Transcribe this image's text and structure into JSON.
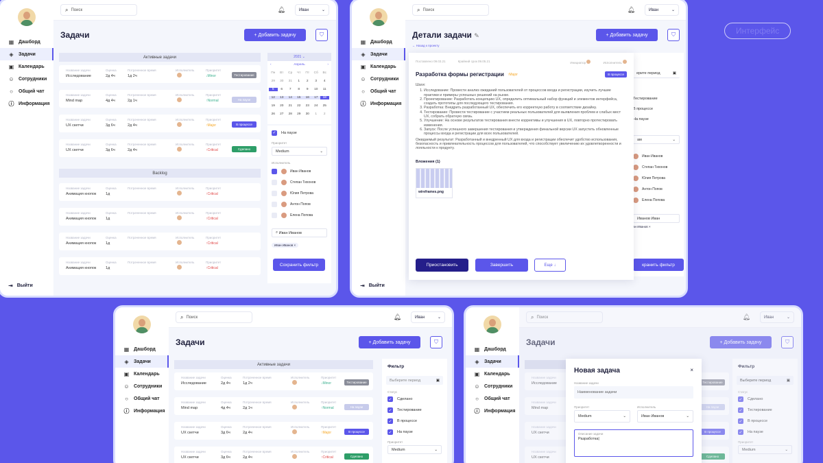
{
  "chip": "Интерфейс",
  "common": {
    "search": "Поиск",
    "user": "Иван",
    "nav": [
      "Дашборд",
      "Задачи",
      "Календарь",
      "Сотрудники",
      "Общий чат",
      "Информация"
    ],
    "exit": "Выйти",
    "tasks_title": "Задачи",
    "add_task": "Добавить задачу",
    "active_tasks": "Активные задачи",
    "backlog": "Backlog",
    "col_name": "Название задачи",
    "col_est": "Оценка",
    "col_spent": "Потраченное время",
    "col_exec": "Исполнитель",
    "col_prio": "Приоритет"
  },
  "tasks": [
    {
      "name": "Исследование",
      "est": "2д 4ч",
      "spent": "1д 2ч",
      "prio": "Minor",
      "status": "Тестирование",
      "status_color": "#8a8d99",
      "prio_color": "#3bb08f"
    },
    {
      "name": "Mind map",
      "est": "4д 4ч",
      "spent": "2д 1ч",
      "prio": "Normal",
      "status": "На паузе",
      "status_color": "#c7cbeb",
      "prio_color": "#3bb08f"
    },
    {
      "name": "UX скетчи",
      "est": "3д 6ч",
      "spent": "2д 4ч",
      "prio": "Major",
      "status": "В процессе",
      "status_color": "#5b56ea",
      "prio_color": "#f5a623"
    },
    {
      "name": "UX скетчи",
      "est": "3д 6ч",
      "spent": "2д 4ч",
      "prio": "Critical",
      "status": "Сделано",
      "status_color": "#2e9e68",
      "prio_color": "#e04848"
    }
  ],
  "backlog_tasks": [
    {
      "name": "Анимация кнопок",
      "est": "1д",
      "prio": "Critical"
    },
    {
      "name": "Анимация кнопок",
      "est": "1д",
      "prio": "Critical"
    },
    {
      "name": "Анимация кнопок",
      "est": "1д",
      "prio": "Critical"
    },
    {
      "name": "Анимация кнопок",
      "est": "1д",
      "prio": "Critical"
    }
  ],
  "calendar": {
    "year": "2021",
    "month": "Апрель",
    "weekdays": [
      "Пн",
      "Вт",
      "Ср",
      "Чт",
      "Пт",
      "Сб",
      "Вс"
    ],
    "days": [
      "29",
      "30",
      "31",
      "1",
      "2",
      "3",
      "4",
      "5",
      "6",
      "7",
      "8",
      "9",
      "10",
      "11",
      "12",
      "13",
      "14",
      "15",
      "16",
      "17",
      "18",
      "19",
      "20",
      "21",
      "22",
      "23",
      "24",
      "25",
      "26",
      "27",
      "28",
      "29",
      "30",
      "1",
      "2"
    ]
  },
  "filter": {
    "title": "Фильтр",
    "period": "Выберите период",
    "status_label": "Статус",
    "statuses": [
      "Сделано",
      "Тестирование",
      "В процессе",
      "На паузе"
    ],
    "prio_label": "Приоритет",
    "prio_value": "Medium",
    "exec_label": "Исполнитель",
    "people": [
      "Иван Иванов",
      "Степан Тихонов",
      "Юлия Петрова",
      "Антон Попов",
      "Елена Попова"
    ],
    "search_person": "Иван Иванов",
    "save": "Сохранить фильтр"
  },
  "details": {
    "title": "Детали задачи",
    "back": "Назад к проекту",
    "posted": "Поставлено 09.03.21",
    "deadline": "Крайний срок 09.05.21",
    "author": "Инициатор",
    "executor": "Исполнитель",
    "task_name": "Разработка формы регистрации",
    "prio": "Major",
    "status": "В процессе",
    "steps_label": "Шаги:",
    "steps": [
      "Исследование: Провести анализ ожиданий пользователей от процессов входа и регистрации, изучить лучшие практики и примеры успешных решений на рынке.",
      "Проектирование: Разработать концепцию UX, определить оптимальный набор функций и элементов интерфейса, создать прототипы для последующего тестирования.",
      "Разработка: Внедрить разработанный UX, обеспечить его корректную работу в соответствие дизайну.",
      "Тестирование: Провести тестирование с участием реальных пользователей для выявления проблем и слабых мест UX, собрать обратную связь.",
      "Улучшение: На основе результатов тестирования внести коррективы и улучшения в UX, повторно протестировать изменения.",
      "Запуск: После успешного завершения тестирования и утверждения финальной версии UX запустить обновленные процессы входа и регистрации для всех пользователей."
    ],
    "result": "Ожидаемый результат: Разработанный и внедренный UX для входа и регистрации обеспечит удобство использования, безопасность и привлекательность процессов для пользователей, что способствует увеличению их удовлетворенности и лояльности к продукту.",
    "attach_label": "Вложения (1)",
    "file": "wireframes.png",
    "suspend": "Приостановить",
    "finish": "Завершить",
    "more": "Еще",
    "right_names": [
      "Иван Иванов",
      "Степан Тихонов",
      "Юлия Петрова",
      "Антон Попов",
      "Елена Попова"
    ],
    "right_statuses": [
      "Тестирование",
      "В процессе",
      "На паузе"
    ],
    "right_period": "ерите период",
    "right_person": "Иванов Иван",
    "right_chip": "ан Иванов"
  },
  "modal": {
    "title": "Новая задача",
    "close": "×",
    "name_label": "Название задачи",
    "name_placeholder": "Наименование задачи",
    "prio_label": "Приоритет",
    "prio_value": "Medium",
    "exec_label": "Исполнитель",
    "exec_value": "Иван Иванов",
    "desc_label": "Описание задачи",
    "desc_value": "Разработка"
  }
}
